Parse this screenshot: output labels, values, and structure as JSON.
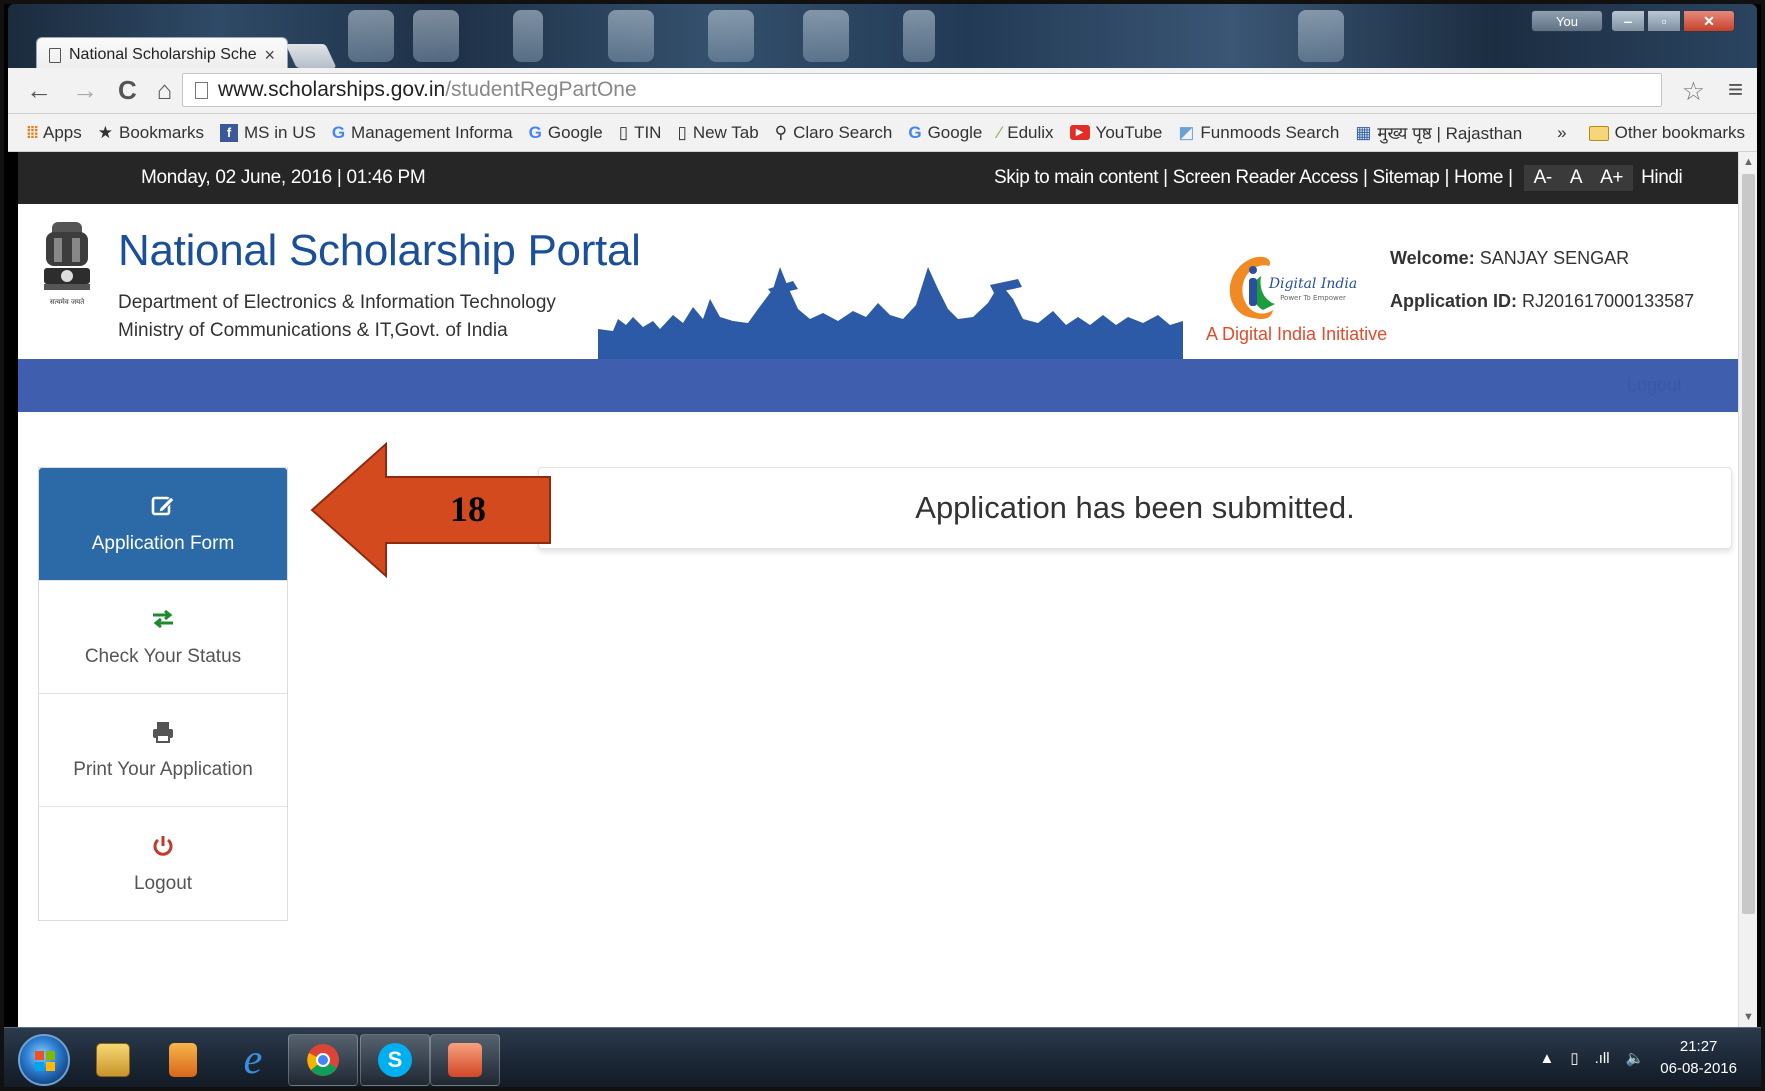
{
  "browser": {
    "tab_title": "National Scholarship Sche",
    "tab_close": "×",
    "url_host": "www.scholarships.gov.in",
    "url_path": "/studentRegPartOne",
    "window_you": "You",
    "bookmarks": [
      {
        "label": "Apps",
        "icon": "apps-grid-icon"
      },
      {
        "label": "Bookmarks",
        "icon": "star-icon"
      },
      {
        "label": "MS in US",
        "icon": "facebook-icon"
      },
      {
        "label": "Management Informa",
        "icon": "google-icon"
      },
      {
        "label": "Google",
        "icon": "google-icon"
      },
      {
        "label": "TIN",
        "icon": "page-icon"
      },
      {
        "label": "New Tab",
        "icon": "page-icon"
      },
      {
        "label": "Claro Search",
        "icon": "search-icon"
      },
      {
        "label": "Google",
        "icon": "google-icon"
      },
      {
        "label": "Edulix",
        "icon": "edulix-icon"
      },
      {
        "label": "YouTube",
        "icon": "youtube-icon"
      },
      {
        "label": "Funmoods Search",
        "icon": "funmoods-icon"
      },
      {
        "label": "मुख्य पृष्ठ | Rajasthan",
        "icon": "grid-icon"
      }
    ],
    "bookmarks_overflow": "»",
    "other_bookmarks": "Other bookmarks"
  },
  "topbar": {
    "date": "Monday, 02 June, 2016 | 01:46 PM",
    "skip": "Skip to main content",
    "screen_reader": "Screen Reader Access",
    "sitemap": "Sitemap",
    "home": "Home",
    "sep": "|",
    "font_small": "A-",
    "font_normal": "A",
    "font_large": "A+",
    "hindi": "Hindi"
  },
  "header": {
    "title": "National Scholarship Portal",
    "dept": "Department of Electronics & Information Technology",
    "ministry": "Ministry of Communications & IT,Govt. of India",
    "emblem_caption": "सत्यमेव जयते",
    "digital_india": "Digital India",
    "digital_india_tag": "Power To Empower",
    "di_caption": "A Digital India Initiative",
    "welcome_label": "Welcome:",
    "welcome_name": "SANJAY SENGAR",
    "appid_label": "Application ID:",
    "appid_value": "RJ201617000133587"
  },
  "navband": {
    "logout": "Logout"
  },
  "sidebar": {
    "items": [
      {
        "label": "Application Form",
        "icon": "edit-icon",
        "active": true
      },
      {
        "label": "Check Your Status",
        "icon": "exchange-arrows-icon",
        "active": false
      },
      {
        "label": "Print Your Application",
        "icon": "print-icon",
        "active": false
      },
      {
        "label": "Logout",
        "icon": "power-icon",
        "active": false
      }
    ]
  },
  "main": {
    "message": "Application has been submitted."
  },
  "annotation": {
    "step_number": "18",
    "arrow_color": "#d44a1f"
  },
  "taskbar": {
    "time": "21:27",
    "date": "06-08-2016"
  },
  "colors": {
    "brand_blue": "#1b4f9a",
    "nav_band": "#3f5fae",
    "sidebar_active": "#2b6aa6",
    "topbar_bg": "#262626",
    "di_orange": "#e24c2b"
  }
}
